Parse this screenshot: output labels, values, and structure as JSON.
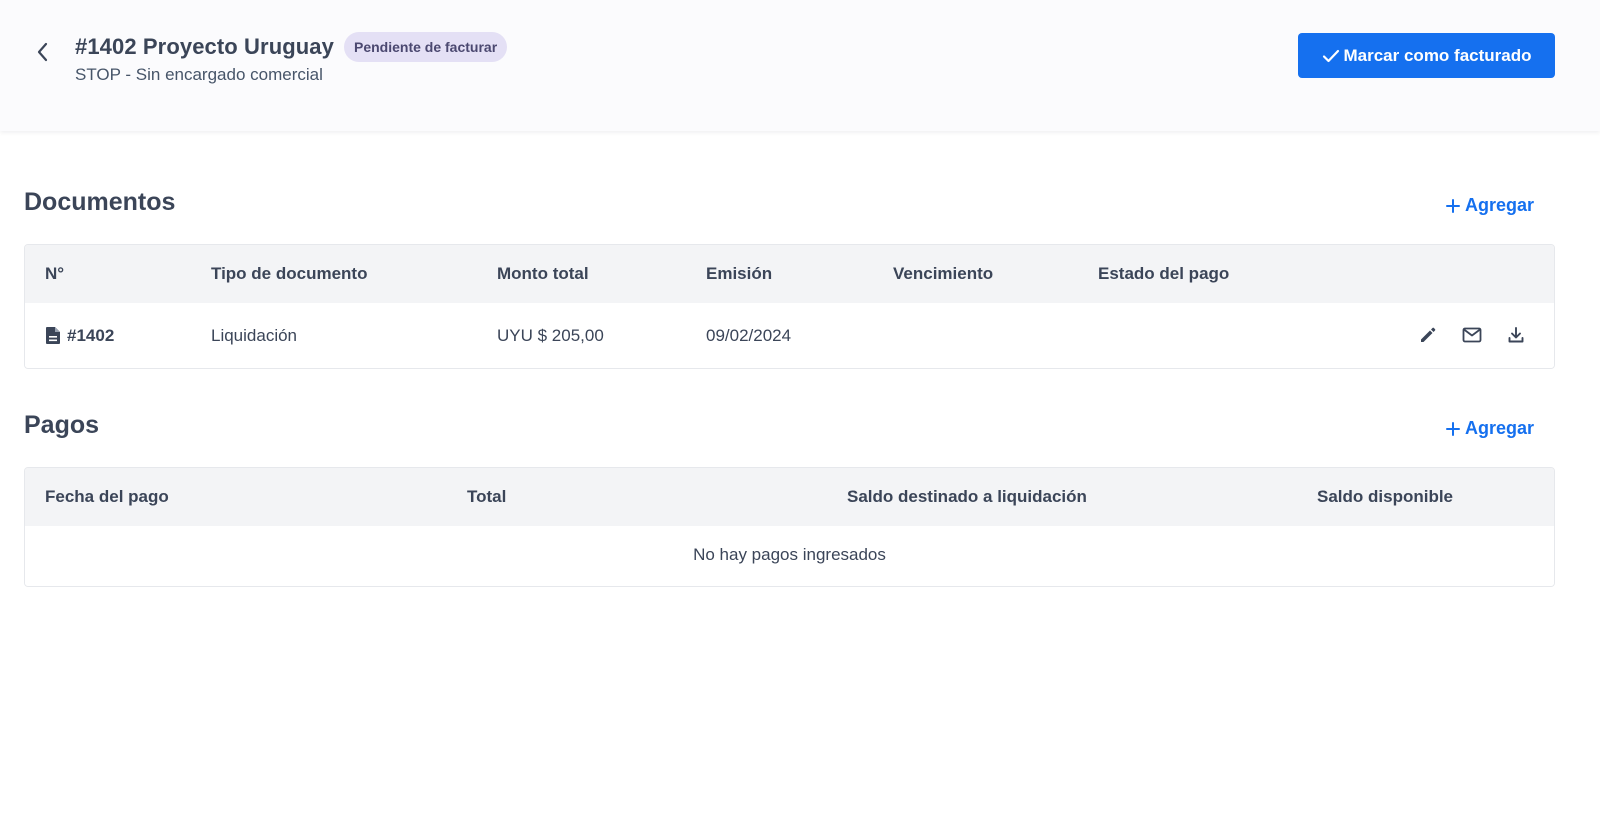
{
  "header": {
    "back_icon": "chevron-left-icon",
    "title": "#1402 Proyecto Uruguay",
    "status_badge": "Pendiente de facturar",
    "subtitle": "STOP - Sin encargado comercial",
    "primary_action": {
      "icon": "check-icon",
      "label": "Marcar como facturado"
    }
  },
  "documents": {
    "title": "Documentos",
    "add_label": "Agregar",
    "columns": [
      "N°",
      "Tipo de documento",
      "Monto total",
      "Emisión",
      "Vencimiento",
      "Estado del pago"
    ],
    "rows": [
      {
        "number": "#1402",
        "type": "Liquidación",
        "amount": "UYU $ 205,00",
        "issued": "09/02/2024",
        "due": "",
        "payment_status": "",
        "actions": [
          "edit-icon",
          "mail-icon",
          "download-icon"
        ]
      }
    ]
  },
  "payments": {
    "title": "Pagos",
    "add_label": "Agregar",
    "columns": [
      "Fecha del pago",
      "Total",
      "Saldo destinado a liquidación",
      "Saldo disponible"
    ],
    "empty_message": "No hay pagos ingresados"
  },
  "colors": {
    "primary": "#1570ef",
    "badge_bg": "#e4e0f5",
    "header_bg": "#fbfbfd",
    "table_header_bg": "#f3f4f6",
    "text": "#3b4558"
  }
}
